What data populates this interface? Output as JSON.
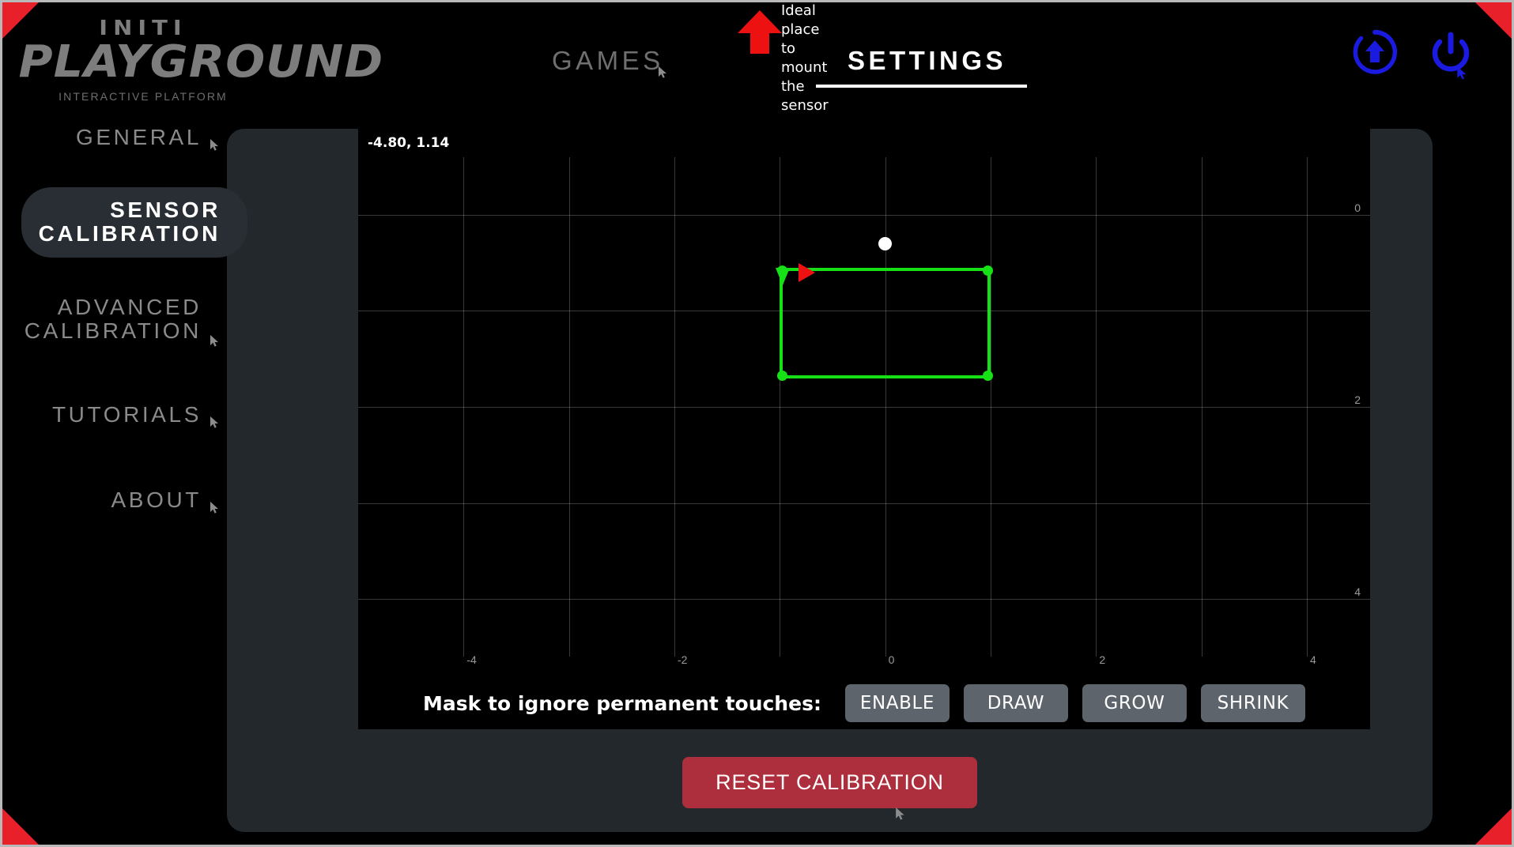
{
  "brand": {
    "name_top": "INITI",
    "name_main": "PLAYGROUND",
    "tagline": "INTERACTIVE PLATFORM"
  },
  "topnav": {
    "tabs": [
      {
        "label": "GAMES",
        "active": false
      },
      {
        "label": "SETTINGS",
        "active": true
      }
    ]
  },
  "annotation": {
    "text": "Ideal place to mount\nthe sensor",
    "arrow_color": "#ee1111"
  },
  "header_icons": [
    {
      "name": "update-icon",
      "color": "#1a1ae0"
    },
    {
      "name": "power-icon",
      "color": "#1a1ae0"
    }
  ],
  "sidebar": {
    "items": [
      {
        "label": "GENERAL",
        "active": false
      },
      {
        "label": "SENSOR\nCALIBRATION",
        "active": true
      },
      {
        "label": "ADVANCED\nCALIBRATION",
        "active": false
      },
      {
        "label": "TUTORIALS",
        "active": false
      },
      {
        "label": "ABOUT",
        "active": false
      }
    ]
  },
  "plot": {
    "coord_readout": "-4.80, 1.14"
  },
  "mask_toolbar": {
    "label": "Mask to ignore permanent touches:",
    "buttons": [
      {
        "label": "ENABLE"
      },
      {
        "label": "DRAW"
      },
      {
        "label": "GROW"
      },
      {
        "label": "SHRINK"
      }
    ]
  },
  "reset": {
    "label": "RESET CALIBRATION",
    "color": "#ad2e3c"
  },
  "colors": {
    "background": "#000000",
    "panel": "#22282c",
    "accent_green": "#16e016",
    "accent_red": "#e8202a",
    "accent_blue": "#1a1ae0",
    "muted_text": "#8a8a8a"
  },
  "chart_data": {
    "type": "scatter",
    "title": "",
    "xlabel": "",
    "ylabel": "",
    "xlim": [
      -5.0,
      4.6
    ],
    "ylim": [
      -0.6,
      4.6
    ],
    "x_ticks": [
      -4,
      -2,
      0,
      2,
      4
    ],
    "y_ticks": [
      0,
      2,
      4
    ],
    "y_axis_position": "right",
    "y_axis_direction": "down",
    "grid": true,
    "grid_x": [
      -4,
      -3,
      -2,
      -1,
      0,
      1,
      2,
      3,
      4
    ],
    "grid_y": [
      0,
      1,
      2,
      3,
      4
    ],
    "readout_point": {
      "x": -4.8,
      "y": 1.14
    },
    "mask_rectangle": {
      "color": "#16e016",
      "x_min": -1.0,
      "x_max": 1.0,
      "y_min": 0.55,
      "y_max": 1.7,
      "handles": [
        {
          "x": -1.0,
          "y": 0.55
        },
        {
          "x": 1.0,
          "y": 0.55
        },
        {
          "x": -1.0,
          "y": 1.7
        },
        {
          "x": 1.0,
          "y": 1.7
        }
      ]
    },
    "markers": [
      {
        "name": "sensor-origin-dot",
        "shape": "circle",
        "color": "#ffffff",
        "x": 0.0,
        "y": 0.3
      },
      {
        "name": "direction-arrow-x",
        "shape": "triangle-right",
        "color": "#ee1111",
        "x": -0.78,
        "y": 0.55
      },
      {
        "name": "direction-arrow-y",
        "shape": "triangle-down",
        "color": "#16e016",
        "x": -1.0,
        "y": 0.7
      }
    ]
  }
}
